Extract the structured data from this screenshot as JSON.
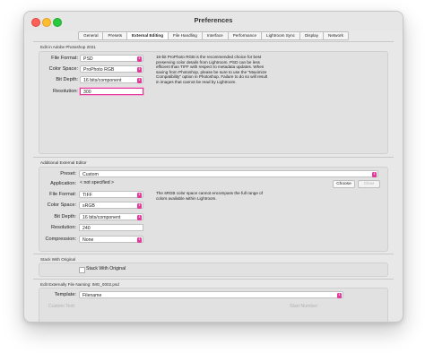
{
  "window": {
    "title": "Preferences"
  },
  "tabs": [
    {
      "label": "General"
    },
    {
      "label": "Presets"
    },
    {
      "label": "External Editing",
      "active": true
    },
    {
      "label": "File Handling"
    },
    {
      "label": "Interface"
    },
    {
      "label": "Performance"
    },
    {
      "label": "Lightroom Sync"
    },
    {
      "label": "Display"
    },
    {
      "label": "Network"
    }
  ],
  "photoshop": {
    "section_title": "Edit in Adobe Photoshop 2021",
    "file_format": {
      "label": "File Format:",
      "value": "PSD"
    },
    "color_space": {
      "label": "Color Space:",
      "value": "ProPhoto RGB"
    },
    "bit_depth": {
      "label": "Bit Depth:",
      "value": "16 bits/component"
    },
    "resolution": {
      "label": "Resolution:",
      "value": "300"
    },
    "note": "16-bit ProPhoto RGB is the recommended choice for best preserving color details from Lightroom. PSD can be less efficient than TIFF with respect to metadata updates. When saving from Photoshop, please be sure to use the \"Maximize Compatibility\" option in Photoshop. Failure to do so will result in images that cannot be read by Lightroom."
  },
  "additional": {
    "section_title": "Additional External Editor",
    "preset": {
      "label": "Preset:",
      "value": "Custom"
    },
    "application": {
      "label": "Application:",
      "value": "< not specified >"
    },
    "choose_label": "Choose",
    "clear_label": "Clear",
    "file_format": {
      "label": "File Format:",
      "value": "TIFF"
    },
    "color_space": {
      "label": "Color Space:",
      "value": "sRGB"
    },
    "bit_depth": {
      "label": "Bit Depth:",
      "value": "16 bits/component"
    },
    "resolution": {
      "label": "Resolution:",
      "value": "240"
    },
    "compression": {
      "label": "Compression:",
      "value": "None"
    },
    "note": "The sRGB color space cannot encompass the full range of colors available within Lightroom."
  },
  "stack": {
    "section_title": "Stack With Original",
    "checkbox_label": "Stack With Original",
    "checked": false
  },
  "naming": {
    "section_title": "Edit Externally File Naming:",
    "example": "IMG_0002.psd",
    "template": {
      "label": "Template:",
      "value": "Filename"
    },
    "custom_text_label": "Custom Text:",
    "start_number_label": "Start Number:"
  },
  "colors": {
    "accent": "#e4399a",
    "window_bg": "#e8e8e8"
  }
}
